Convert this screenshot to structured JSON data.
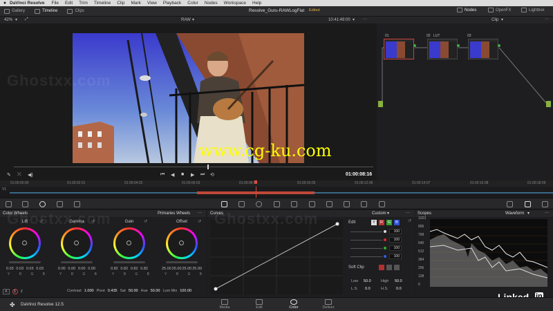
{
  "menubar": {
    "app": "DaVinci Resolve",
    "items": [
      "File",
      "Edit",
      "Trim",
      "Timeline",
      "Clip",
      "Mark",
      "View",
      "Playback",
      "Color",
      "Nodes",
      "Workspace",
      "Help"
    ]
  },
  "toolbar": {
    "gallery": "Gallery",
    "timeline": "Timeline",
    "clips": "Clips",
    "project_title": "Resolve_Guru-RAWLogFlat",
    "edited": "Edited",
    "nodes": "Nodes",
    "openfx": "OpenFX",
    "lightbox": "Lightbox"
  },
  "viewer": {
    "zoom": "42%",
    "mode": "RAW",
    "timecode_top": "10:41:49:00",
    "clip_mode": "Clip",
    "current_timecode": "01:00:08:16"
  },
  "ruler": {
    "ticks": [
      "01:00:00:00",
      "01:00:02:01",
      "01:00:04:02",
      "01:00:06:03",
      "01:00:08:04",
      "01:00:10:05",
      "01:00:12:06",
      "01:00:14:07",
      "01:00:16:08",
      "01:00:18:09"
    ],
    "track": "V1"
  },
  "nodes": [
    {
      "num": "01",
      "label": ""
    },
    {
      "num": "02",
      "label": "LUT"
    },
    {
      "num": "03",
      "label": ""
    }
  ],
  "color_wheels": {
    "title": "Color Wheels",
    "mode": "Primaries Wheels",
    "wheels": [
      {
        "name": "Lift",
        "values": [
          "0.03",
          "0.03",
          "0.03",
          "0.03"
        ]
      },
      {
        "name": "Gamma",
        "values": [
          "0.00",
          "0.00",
          "0.00",
          "0.00"
        ]
      },
      {
        "name": "Gain",
        "values": [
          "0.82",
          "0.82",
          "0.82",
          "0.82"
        ]
      },
      {
        "name": "Offset",
        "values": [
          "25.00",
          "25.00",
          "25.00",
          "25.00"
        ]
      }
    ],
    "channels": [
      "Y",
      "R",
      "G",
      "B"
    ],
    "controls": {
      "a_label": "A",
      "page1": "1",
      "page2": "2",
      "contrast_label": "Contrast",
      "contrast": "1.000",
      "pivot_label": "Pivot",
      "pivot": "0.435",
      "sat_label": "Sat",
      "sat": "50.00",
      "hue_label": "Hue",
      "hue": "50.00",
      "lummix_label": "Lum Mix",
      "lummix": "100.00"
    }
  },
  "curves": {
    "title": "Curves",
    "mode": "Custom",
    "edit_label": "Edit",
    "edit_values": [
      "100",
      "100",
      "100",
      "100"
    ],
    "soft_clip_label": "Soft Clip",
    "low_label": "Low",
    "low": "50.0",
    "high_label": "High",
    "high": "50.0",
    "ls_label": "L.S.",
    "ls": "0.0",
    "hs_label": "H.S.",
    "hs": "0.0",
    "channel_buttons": [
      "Y",
      "R",
      "G",
      "B"
    ]
  },
  "scopes": {
    "title": "Scopes",
    "mode": "Waveform",
    "scale": [
      "1023",
      "896",
      "768",
      "640",
      "512",
      "384",
      "256",
      "128",
      "0"
    ]
  },
  "bottom": {
    "app_name": "DaVinci Resolve 12.5",
    "pages": [
      "Media",
      "Edit",
      "Color",
      "Deliver"
    ]
  },
  "watermarks": {
    "ghost": "Ghostxx.com",
    "cg": "www.cg-ku.com",
    "linkedin": "Linked",
    "linkedin_in": "in"
  },
  "colors": {
    "accent": "#d9a13a",
    "playhead": "#e04a3a",
    "selected_node": "#d04040"
  }
}
